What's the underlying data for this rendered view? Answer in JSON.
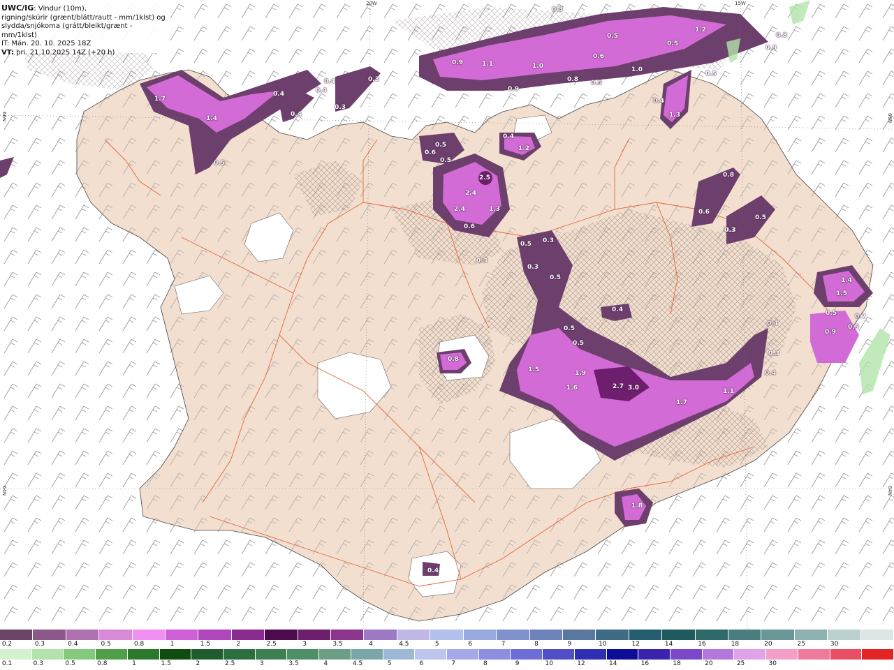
{
  "map": {
    "title_strong": "UWC/IG",
    "title_rest": ": Vindur (10m),",
    "description_line2": "rigning/skúrir (grænt/blátt/rautt - mm/1klst) og",
    "description_line3": "slydda/snjókoma (grátt/bleikt/grænt - mm/1klst)",
    "issue_time": "IT: Mán. 20. 10. 2025 18Z",
    "valid_label": "VT:",
    "valid_time": "þri. 21.10.2025 14Z (+20 h)",
    "grid_labels": {
      "lon_20w": "20W",
      "lon_15w": "15W",
      "lat_66n_left": "66N",
      "lat_66n_right": "66N",
      "lat_64n_left": "64N",
      "lat_64n_right": "64N"
    },
    "land_color": "#f3dfcf",
    "road_color": "#e4643a",
    "snow_colors": [
      "#6d3f6d",
      "#d36bd6",
      "#e89cf0"
    ]
  },
  "precip_labels": [
    "0.3",
    "1.2",
    "0.5",
    "0.8",
    "0.9",
    "0.5",
    "1.7",
    "1.4",
    "0.4",
    "0.4",
    "0.4",
    "0.3",
    "0.4",
    "0.3",
    "0.5",
    "0.9",
    "1.1",
    "1.0",
    "0.9",
    "0.8",
    "0.6",
    "1.0",
    "0.5",
    "0.5",
    "0.4",
    "0.4",
    "1.2",
    "1.3",
    "0.5",
    "0.5",
    "0.6",
    "2.5",
    "2.4",
    "2.4",
    "1.3",
    "0.6",
    "0.5",
    "0.3",
    "0.3",
    "0.5",
    "0.3",
    "0.8",
    "0.6",
    "0.5",
    "0.3",
    "0.4",
    "0.5",
    "0.5",
    "0.8",
    "1.5",
    "1.9",
    "1.6",
    "2.7",
    "3.0",
    "1.7",
    "1.1",
    "0.4",
    "0.3",
    "1.4",
    "1.5",
    "0.5",
    "0.9",
    "0.7",
    "0.5",
    "1.8",
    "0.4",
    "0.3",
    "0.4"
  ],
  "legend_snow": {
    "colors": [
      "#6b4468",
      "#8e578c",
      "#b071b0",
      "#d78ad7",
      "#f28ff2",
      "#d060d8",
      "#b045bc",
      "#8a2c8e",
      "#4e0a4e",
      "#6d1f6d",
      "#8c358c",
      "#9e79c4",
      "#bfb7e6",
      "#b3c0ec",
      "#98a9de",
      "#7f92cc",
      "#6d83b9",
      "#5878a0",
      "#3f6c85",
      "#245d6d",
      "#1f5a5e",
      "#2e6a6a",
      "#4a7e7e",
      "#6a9898",
      "#8db2b2",
      "#bcd0d0",
      "#dde6e6"
    ],
    "labels": [
      "0.2",
      "0.3",
      "0.4",
      "0.5",
      "0.8",
      "1",
      "1.5",
      "2",
      "2.5",
      "3",
      "3.5",
      "4",
      "4.5",
      "5",
      "6",
      "7",
      "8",
      "9",
      "10",
      "12",
      "14",
      "16",
      "18",
      "20",
      "25",
      "30"
    ]
  },
  "legend_rain": {
    "colors": [
      "#d4f2d0",
      "#b1e3aa",
      "#84c97c",
      "#4f9e49",
      "#2b7a2b",
      "#0f4d0f",
      "#1f5d2e",
      "#2b6e3f",
      "#3d7f52",
      "#4f8f68",
      "#6a9f86",
      "#7aa5a9",
      "#9db7d6",
      "#bdc5ee",
      "#a6a8ea",
      "#8c8ee2",
      "#6e6fd6",
      "#4f50c7",
      "#2e2fb2",
      "#0d0d98",
      "#3a24ae",
      "#7a48c8",
      "#b278dc",
      "#e0a2e8",
      "#f2a0c8",
      "#ef7a9c",
      "#e84f64",
      "#e32424"
    ],
    "labels": [
      "0.1",
      "0.3",
      "0.5",
      "0.8",
      "1",
      "1.5",
      "2",
      "2.5",
      "3",
      "3.5",
      "4",
      "4.5",
      "5",
      "6",
      "7",
      "8",
      "9",
      "10",
      "12",
      "14",
      "16",
      "18",
      "20",
      "25",
      "30"
    ]
  }
}
